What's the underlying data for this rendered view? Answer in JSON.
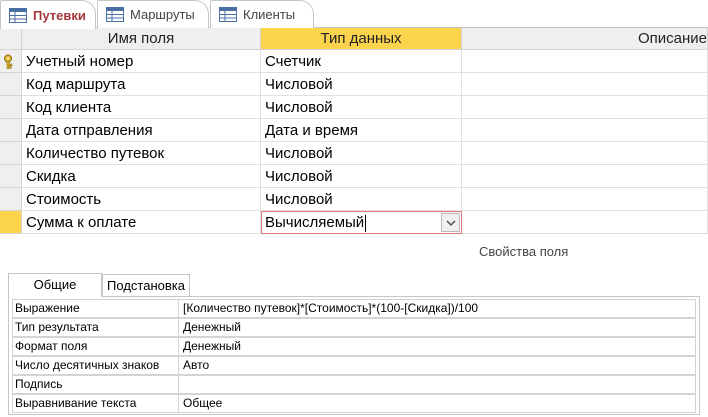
{
  "tabs": [
    {
      "label": "Путевки",
      "active": true
    },
    {
      "label": "Маршруты",
      "active": false
    },
    {
      "label": "Клиенты",
      "active": false
    }
  ],
  "grid": {
    "headers": {
      "field_name": "Имя поля",
      "data_type": "Тип данных",
      "description": "Описание"
    },
    "rows": [
      {
        "name": "Учетный номер",
        "type": "Счетчик",
        "primary_key": true
      },
      {
        "name": "Код маршрута",
        "type": "Числовой"
      },
      {
        "name": "Код клиента",
        "type": "Числовой"
      },
      {
        "name": "Дата отправления",
        "type": "Дата и время"
      },
      {
        "name": "Количество путевок",
        "type": "Числовой"
      },
      {
        "name": "Скидка",
        "type": "Числовой"
      },
      {
        "name": "Стоимость",
        "type": "Числовой"
      },
      {
        "name": "Сумма к оплате",
        "type": "Вычисляемый",
        "current": true
      }
    ]
  },
  "field_properties_title": "Свойства поля",
  "property_tabs": [
    {
      "label": "Общие",
      "active": true
    },
    {
      "label": "Подстановка",
      "active": false
    }
  ],
  "properties": [
    {
      "label": "Выражение",
      "value": "[Количество путевок]*[Стоимость]*(100-[Скидка])/100"
    },
    {
      "label": "Тип результата",
      "value": "Денежный"
    },
    {
      "label": "Формат поля",
      "value": "Денежный"
    },
    {
      "label": "Число десятичных знаков",
      "value": "Авто"
    },
    {
      "label": "Подпись",
      "value": ""
    },
    {
      "label": "Выравнивание текста",
      "value": "Общее"
    }
  ],
  "colors": {
    "accent": "#a4373a",
    "selection": "#fcd34d",
    "combo_border": "#e07b7b"
  },
  "icons": {
    "tab": "table-icon",
    "row_key": "primary-key-icon",
    "combo": "chevron-down-icon"
  }
}
